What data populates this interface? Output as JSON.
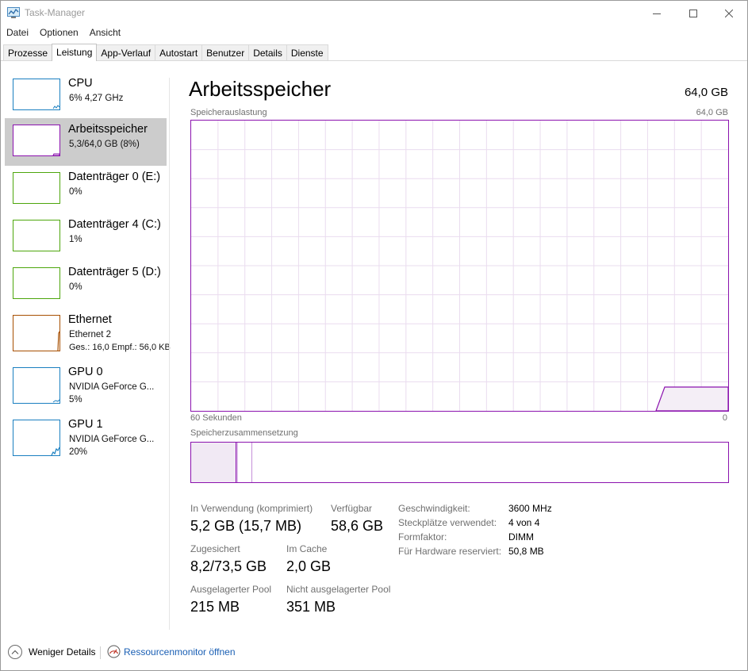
{
  "window": {
    "title": "Task-Manager",
    "icon": "task-manager-icon",
    "controls": [
      "minimize-icon",
      "maximize-icon",
      "close-icon"
    ]
  },
  "menu": [
    "Datei",
    "Optionen",
    "Ansicht"
  ],
  "tabs": [
    "Prozesse",
    "Leistung",
    "App-Verlauf",
    "Autostart",
    "Benutzer",
    "Details",
    "Dienste"
  ],
  "active_tab": "Leistung",
  "sidebar": {
    "items": [
      {
        "name": "CPU",
        "sub": "6%  4,27 GHz",
        "sub2": "",
        "color": "#1a7fc0",
        "selected": false
      },
      {
        "name": "Arbeitsspeicher",
        "sub": "5,3/64,0 GB (8%)",
        "sub2": "",
        "color": "#8b12ae",
        "selected": true
      },
      {
        "name": "Datenträger 0 (E:)",
        "sub": "0%",
        "sub2": "",
        "color": "#4da60c",
        "selected": false
      },
      {
        "name": "Datenträger 4 (C:)",
        "sub": "1%",
        "sub2": "",
        "color": "#4da60c",
        "selected": false
      },
      {
        "name": "Datenträger 5 (D:)",
        "sub": "0%",
        "sub2": "",
        "color": "#4da60c",
        "selected": false
      },
      {
        "name": "Ethernet",
        "sub": "Ethernet 2",
        "sub2": "Ges.: 16,0  Empf.: 56,0 KB",
        "color": "#a74f01",
        "selected": false
      },
      {
        "name": "GPU 0",
        "sub": "NVIDIA GeForce G...",
        "sub2": "5%",
        "color": "#1a7fc0",
        "selected": false
      },
      {
        "name": "GPU 1",
        "sub": "NVIDIA GeForce G...",
        "sub2": "20%",
        "color": "#1a7fc0",
        "selected": false
      }
    ]
  },
  "main": {
    "title": "Arbeitsspeicher",
    "total": "64,0 GB",
    "usage_label": "Speicherauslastung",
    "usage_max": "64,0 GB",
    "time_left": "60 Sekunden",
    "time_right": "0",
    "composition_label": "Speicherzusammensetzung",
    "accent_color": "#8b12ae",
    "stats": {
      "in_use_label": "In Verwendung (komprimiert)",
      "in_use_value": "5,2 GB (15,7 MB)",
      "available_label": "Verfügbar",
      "available_value": "58,6 GB",
      "committed_label": "Zugesichert",
      "committed_value": "8,2/73,5 GB",
      "cached_label": "Im Cache",
      "cached_value": "2,0 GB",
      "paged_label": "Ausgelagerter Pool",
      "paged_value": "215 MB",
      "nonpaged_label": "Nicht ausgelagerter Pool",
      "nonpaged_value": "351 MB"
    },
    "details": [
      {
        "label": "Geschwindigkeit:",
        "value": "3600 MHz"
      },
      {
        "label": "Steckplätze verwendet:",
        "value": "4 von 4"
      },
      {
        "label": "Formfaktor:",
        "value": "DIMM"
      },
      {
        "label": "Für Hardware reserviert:",
        "value": "50,8 MB"
      }
    ]
  },
  "footer": {
    "fewer_details": "Weniger Details",
    "resource_monitor": "Ressourcenmonitor öffnen"
  }
}
